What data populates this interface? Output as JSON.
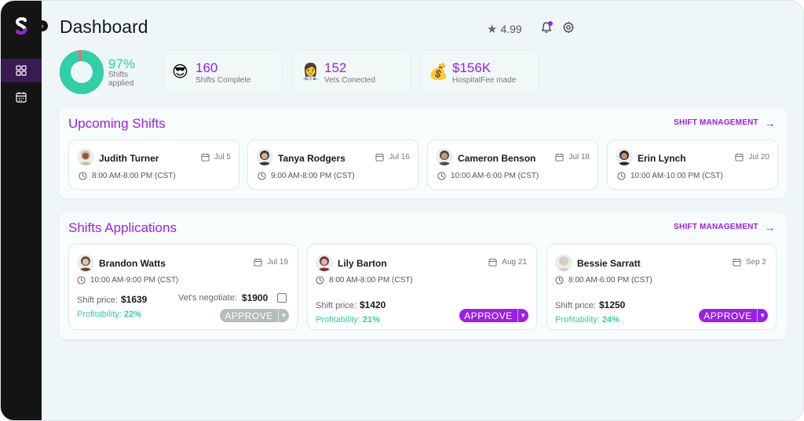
{
  "header": {
    "title": "Dashboard",
    "rating": "4.99"
  },
  "summary": {
    "shifts_applied_pct": "97%",
    "shifts_applied_label": "Shifts applied",
    "shifts_applied_fraction": 0.97,
    "stats": [
      {
        "emoji": "😎",
        "icon": "sunglasses-emoji-icon",
        "value": "160",
        "label": "Shifts Complete"
      },
      {
        "emoji": "👩‍⚕️",
        "icon": "vet-emoji-icon",
        "value": "152",
        "label": "Vets Conected"
      },
      {
        "emoji": "💰",
        "icon": "money-bag-emoji-icon",
        "value": "$156K",
        "label": "HospitalFee made"
      }
    ]
  },
  "upcoming": {
    "title": "Upcoming Shifts",
    "link": "SHIFT MANAGEMENT",
    "items": [
      {
        "name": "Judith Turner",
        "date": "Jul 5",
        "time": "8:00 AM-8:00 PM (CST)"
      },
      {
        "name": "Tanya Rodgers",
        "date": "Jul 16",
        "time": "9:00 AM-8:00 PM (CST)"
      },
      {
        "name": "Cameron Benson",
        "date": "Jul 18",
        "time": "10:00 AM-6:00 PM (CST)"
      },
      {
        "name": "Erin Lynch",
        "date": "Jul 20",
        "time": "10:00 AM-10:00 PM (CST)"
      }
    ]
  },
  "applications": {
    "title": "Shifts Applications",
    "link": "SHIFT MANAGEMENT",
    "price_label": "Shift price:",
    "profit_label": "Profitability:",
    "approve_label": "APPROVE",
    "negotiate_label": "Vet's negotiate:",
    "items": [
      {
        "name": "Brandon Watts",
        "date": "Jul 19",
        "time": "10:00 AM-9:00 PM (CST)",
        "price": "$1639",
        "profit": "22%",
        "negotiate": "$1900"
      },
      {
        "name": "Lily Barton",
        "date": "Aug 21",
        "time": "8:00 AM-8:00 PM (CST)",
        "price": "$1420",
        "profit": "21%"
      },
      {
        "name": "Bessie Sarratt",
        "date": "Sep 2",
        "time": "8:00 AM-6:00 PM (CST)",
        "price": "$1250",
        "profit": "24%"
      }
    ]
  },
  "colors": {
    "accent": "#9b1fe8",
    "teal": "#2fcfa8",
    "donut_remainder": "#f06a6a"
  }
}
